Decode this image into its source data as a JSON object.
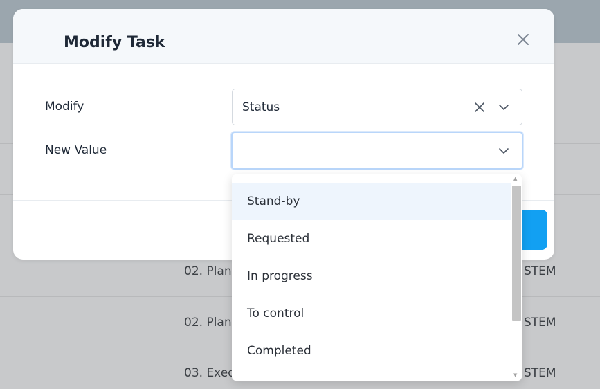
{
  "modal": {
    "title": "Modify Task",
    "close_icon": "close-icon"
  },
  "form": {
    "modify": {
      "label": "Modify",
      "value": "Status"
    },
    "new_value": {
      "label": "New Value",
      "value": ""
    }
  },
  "dropdown": {
    "options": [
      "Stand-by",
      "Requested",
      "In progress",
      "To control",
      "Completed"
    ],
    "highlighted_index": 0
  },
  "background_rows": [
    {
      "left": "02. Plan",
      "right": "STEM"
    },
    {
      "left": "02. Plan",
      "right": "STEM"
    },
    {
      "left": "03. Exec",
      "right": "STEM"
    }
  ],
  "colors": {
    "primary": "#12a0f2",
    "focus_border": "#b9d6fa",
    "highlight": "#eef5fd"
  }
}
